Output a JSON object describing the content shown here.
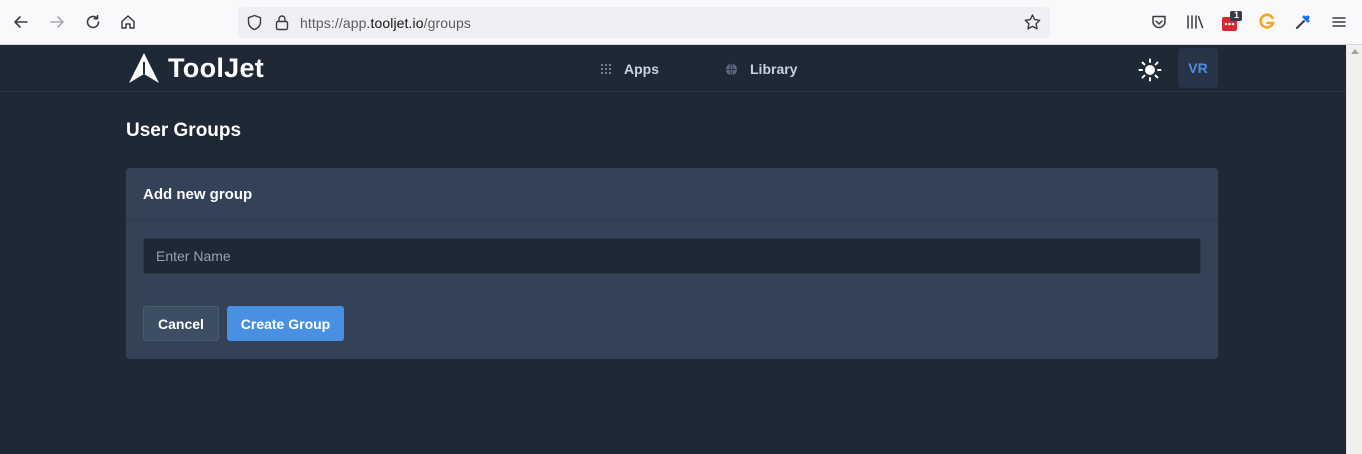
{
  "browser": {
    "url_prefix": "https://app.",
    "url_domain": "tooljet.io",
    "url_path": "/groups",
    "extension_badge": "1"
  },
  "header": {
    "logo_text": "ToolJet",
    "nav": [
      {
        "label": "Apps",
        "icon": "grid-dots-icon"
      },
      {
        "label": "Library",
        "icon": "globe-icon"
      }
    ],
    "theme_icon": "sun-icon",
    "avatar_initials": "VR"
  },
  "page": {
    "title": "User Groups"
  },
  "form": {
    "heading": "Add new group",
    "name_placeholder": "Enter Name",
    "name_value": "",
    "cancel_label": "Cancel",
    "create_label": "Create Group"
  },
  "colors": {
    "background": "#1f2936",
    "card": "#334257",
    "accent": "#4a90e2"
  }
}
